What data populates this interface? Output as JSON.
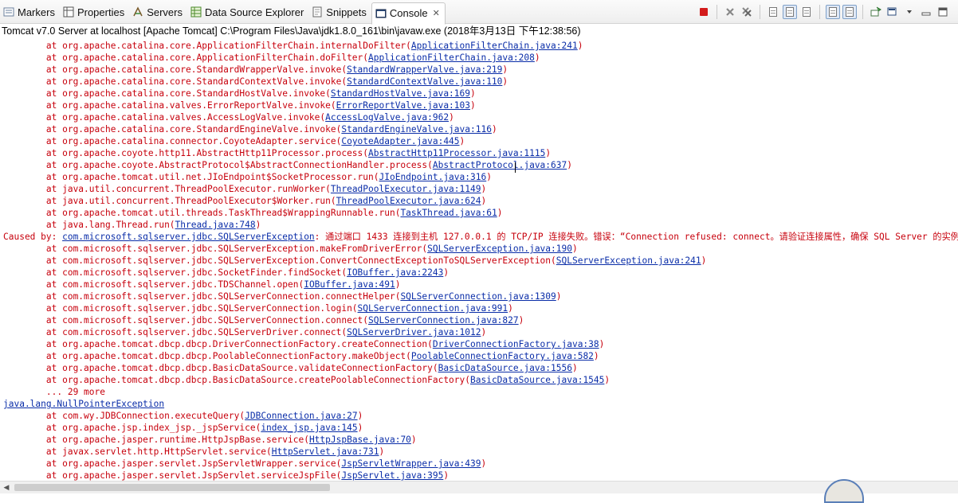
{
  "tabs": [
    {
      "label": "Markers",
      "icon": "markers-icon"
    },
    {
      "label": "Properties",
      "icon": "properties-icon"
    },
    {
      "label": "Servers",
      "icon": "servers-icon"
    },
    {
      "label": "Data Source Explorer",
      "icon": "data-source-icon"
    },
    {
      "label": "Snippets",
      "icon": "snippets-icon"
    },
    {
      "label": "Console",
      "icon": "console-icon",
      "active": true
    }
  ],
  "close_glyph": "✕",
  "process_line": "Tomcat v7.0 Server at localhost [Apache Tomcat] C:\\Program Files\\Java\\jdk1.8.0_161\\bin\\javaw.exe (2018年3月13日 下午12:38:56)",
  "colors": {
    "error": "#c7000c",
    "link": "#0a2da8",
    "terminate": "#d31b1b"
  },
  "console_lines": [
    {
      "text": "\tat org.apache.catalina.core.ApplicationFilterChain.internalDoFilter(",
      "link": "ApplicationFilterChain.java:241",
      "tail": ")"
    },
    {
      "text": "\tat org.apache.catalina.core.ApplicationFilterChain.doFilter(",
      "link": "ApplicationFilterChain.java:208",
      "tail": ")"
    },
    {
      "text": "\tat org.apache.catalina.core.StandardWrapperValve.invoke(",
      "link": "StandardWrapperValve.java:219",
      "tail": ")"
    },
    {
      "text": "\tat org.apache.catalina.core.StandardContextValve.invoke(",
      "link": "StandardContextValve.java:110",
      "tail": ")"
    },
    {
      "text": "\tat org.apache.catalina.core.StandardHostValve.invoke(",
      "link": "StandardHostValve.java:169",
      "tail": ")"
    },
    {
      "text": "\tat org.apache.catalina.valves.ErrorReportValve.invoke(",
      "link": "ErrorReportValve.java:103",
      "tail": ")"
    },
    {
      "text": "\tat org.apache.catalina.valves.AccessLogValve.invoke(",
      "link": "AccessLogValve.java:962",
      "tail": ")"
    },
    {
      "text": "\tat org.apache.catalina.core.StandardEngineValve.invoke(",
      "link": "StandardEngineValve.java:116",
      "tail": ")"
    },
    {
      "text": "\tat org.apache.catalina.connector.CoyoteAdapter.service(",
      "link": "CoyoteAdapter.java:445",
      "tail": ")"
    },
    {
      "text": "\tat org.apache.coyote.http11.AbstractHttp11Processor.process(",
      "link": "AbstractHttp11Processor.java:1115",
      "tail": ")"
    },
    {
      "text": "\tat org.apache.coyote.AbstractProtocol$AbstractConnectionHandler.process(",
      "link": "AbstractProtocol.java:637",
      "tail": ")"
    },
    {
      "text": "\tat org.apache.tomcat.util.net.JIoEndpoint$SocketProcessor.run(",
      "link": "JIoEndpoint.java:316",
      "tail": ")"
    },
    {
      "text": "\tat java.util.concurrent.ThreadPoolExecutor.runWorker(",
      "link": "ThreadPoolExecutor.java:1149",
      "tail": ")"
    },
    {
      "text": "\tat java.util.concurrent.ThreadPoolExecutor$Worker.run(",
      "link": "ThreadPoolExecutor.java:624",
      "tail": ")"
    },
    {
      "text": "\tat org.apache.tomcat.util.threads.TaskThread$WrappingRunnable.run(",
      "link": "TaskThread.java:61",
      "tail": ")"
    },
    {
      "text": "\tat java.lang.Thread.run(",
      "link": "Thread.java:748",
      "tail": ")"
    },
    {
      "text": "Caused by: ",
      "link": "com.microsoft.sqlserver.jdbc.SQLServerException",
      "tail": ": 通过端口 1433 连接到主机 127.0.0.1 的 TCP/IP 连接失败。错误：“Connection refused: connect。请验证连接属性，确保 SQL Server 的实例正在主机上运行"
    },
    {
      "text": "\tat com.microsoft.sqlserver.jdbc.SQLServerException.makeFromDriverError(",
      "link": "SQLServerException.java:190",
      "tail": ")"
    },
    {
      "text": "\tat com.microsoft.sqlserver.jdbc.SQLServerException.ConvertConnectExceptionToSQLServerException(",
      "link": "SQLServerException.java:241",
      "tail": ")"
    },
    {
      "text": "\tat com.microsoft.sqlserver.jdbc.SocketFinder.findSocket(",
      "link": "IOBuffer.java:2243",
      "tail": ")"
    },
    {
      "text": "\tat com.microsoft.sqlserver.jdbc.TDSChannel.open(",
      "link": "IOBuffer.java:491",
      "tail": ")"
    },
    {
      "text": "\tat com.microsoft.sqlserver.jdbc.SQLServerConnection.connectHelper(",
      "link": "SQLServerConnection.java:1309",
      "tail": ")"
    },
    {
      "text": "\tat com.microsoft.sqlserver.jdbc.SQLServerConnection.login(",
      "link": "SQLServerConnection.java:991",
      "tail": ")"
    },
    {
      "text": "\tat com.microsoft.sqlserver.jdbc.SQLServerConnection.connect(",
      "link": "SQLServerConnection.java:827",
      "tail": ")"
    },
    {
      "text": "\tat com.microsoft.sqlserver.jdbc.SQLServerDriver.connect(",
      "link": "SQLServerDriver.java:1012",
      "tail": ")"
    },
    {
      "text": "\tat org.apache.tomcat.dbcp.dbcp.DriverConnectionFactory.createConnection(",
      "link": "DriverConnectionFactory.java:38",
      "tail": ")"
    },
    {
      "text": "\tat org.apache.tomcat.dbcp.dbcp.PoolableConnectionFactory.makeObject(",
      "link": "PoolableConnectionFactory.java:582",
      "tail": ")"
    },
    {
      "text": "\tat org.apache.tomcat.dbcp.dbcp.BasicDataSource.validateConnectionFactory(",
      "link": "BasicDataSource.java:1556",
      "tail": ")"
    },
    {
      "text": "\tat org.apache.tomcat.dbcp.dbcp.BasicDataSource.createPoolableConnectionFactory(",
      "link": "BasicDataSource.java:1545",
      "tail": ")"
    },
    {
      "text": "\t... 29 more",
      "link": "",
      "tail": ""
    },
    {
      "text": "",
      "link": "java.lang.NullPointerException",
      "tail": ""
    },
    {
      "text": "\tat com.wy.JDBConnection.executeQuery(",
      "link": "JDBConnection.java:27",
      "tail": ")"
    },
    {
      "text": "\tat org.apache.jsp.index_jsp._jspService(",
      "link": "index_jsp.java:145",
      "tail": ")"
    },
    {
      "text": "\tat org.apache.jasper.runtime.HttpJspBase.service(",
      "link": "HttpJspBase.java:70",
      "tail": ")"
    },
    {
      "text": "\tat javax.servlet.http.HttpServlet.service(",
      "link": "HttpServlet.java:731",
      "tail": ")"
    },
    {
      "text": "\tat org.apache.jasper.servlet.JspServletWrapper.service(",
      "link": "JspServletWrapper.java:439",
      "tail": ")"
    },
    {
      "text": "\tat org.apache.jasper.servlet.JspServlet.serviceJspFile(",
      "link": "JspServlet.java:395",
      "tail": ")"
    }
  ],
  "scrollbar": {
    "left_arrow": "◀"
  }
}
